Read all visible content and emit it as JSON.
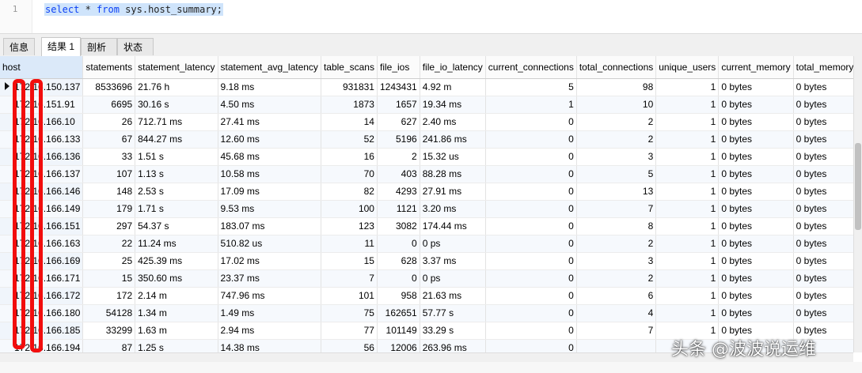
{
  "editor": {
    "line_number": "1",
    "query_keyword_select": "select",
    "query_star": " * ",
    "query_keyword_from": "from",
    "query_rest": " sys.host_summary;"
  },
  "tabs": [
    {
      "label": "信息"
    },
    {
      "label": "结果 1"
    },
    {
      "label": "剖析"
    },
    {
      "label": "状态"
    }
  ],
  "columns": [
    "host",
    "statements",
    "statement_latency",
    "statement_avg_latency",
    "table_scans",
    "file_ios",
    "file_io_latency",
    "current_connections",
    "total_connections",
    "unique_users",
    "current_memory",
    "total_memory"
  ],
  "rows": [
    [
      "172.16.150.137",
      "8533696",
      "21.76 h",
      "9.18 ms",
      "931831",
      "1243431",
      "4.92 m",
      "5",
      "98",
      "1",
      "0 bytes",
      "0 bytes"
    ],
    [
      "172.16.151.91",
      "6695",
      "30.16 s",
      "4.50 ms",
      "1873",
      "1657",
      "19.34 ms",
      "1",
      "10",
      "1",
      "0 bytes",
      "0 bytes"
    ],
    [
      "172.16.166.10",
      "26",
      "712.71 ms",
      "27.41 ms",
      "14",
      "627",
      "2.40 ms",
      "0",
      "2",
      "1",
      "0 bytes",
      "0 bytes"
    ],
    [
      "172.16.166.133",
      "67",
      "844.27 ms",
      "12.60 ms",
      "52",
      "5196",
      "241.86 ms",
      "0",
      "2",
      "1",
      "0 bytes",
      "0 bytes"
    ],
    [
      "172.16.166.136",
      "33",
      "1.51 s",
      "45.68 ms",
      "16",
      "2",
      "15.32 us",
      "0",
      "3",
      "1",
      "0 bytes",
      "0 bytes"
    ],
    [
      "172.16.166.137",
      "107",
      "1.13 s",
      "10.58 ms",
      "70",
      "403",
      "88.28 ms",
      "0",
      "5",
      "1",
      "0 bytes",
      "0 bytes"
    ],
    [
      "172.16.166.146",
      "148",
      "2.53 s",
      "17.09 ms",
      "82",
      "4293",
      "27.91 ms",
      "0",
      "13",
      "1",
      "0 bytes",
      "0 bytes"
    ],
    [
      "172.16.166.149",
      "179",
      "1.71 s",
      "9.53 ms",
      "100",
      "1121",
      "3.20 ms",
      "0",
      "7",
      "1",
      "0 bytes",
      "0 bytes"
    ],
    [
      "172.16.166.151",
      "297",
      "54.37 s",
      "183.07 ms",
      "123",
      "3082",
      "174.44 ms",
      "0",
      "8",
      "1",
      "0 bytes",
      "0 bytes"
    ],
    [
      "172.16.166.163",
      "22",
      "11.24 ms",
      "510.82 us",
      "11",
      "0",
      "0 ps",
      "0",
      "2",
      "1",
      "0 bytes",
      "0 bytes"
    ],
    [
      "172.16.166.169",
      "25",
      "425.39 ms",
      "17.02 ms",
      "15",
      "628",
      "3.37 ms",
      "0",
      "3",
      "1",
      "0 bytes",
      "0 bytes"
    ],
    [
      "172.16.166.171",
      "15",
      "350.60 ms",
      "23.37 ms",
      "7",
      "0",
      "0 ps",
      "0",
      "2",
      "1",
      "0 bytes",
      "0 bytes"
    ],
    [
      "172.16.166.172",
      "172",
      "2.14 m",
      "747.96 ms",
      "101",
      "958",
      "21.63 ms",
      "0",
      "6",
      "1",
      "0 bytes",
      "0 bytes"
    ],
    [
      "172.16.166.180",
      "54128",
      "1.34 m",
      "1.49 ms",
      "75",
      "162651",
      "57.77 s",
      "0",
      "4",
      "1",
      "0 bytes",
      "0 bytes"
    ],
    [
      "172.16.166.185",
      "33299",
      "1.63 m",
      "2.94 ms",
      "77",
      "101149",
      "33.29 s",
      "0",
      "7",
      "1",
      "0 bytes",
      "0 bytes"
    ],
    [
      "172.16.166.194",
      "87",
      "1.25 s",
      "14.38 ms",
      "56",
      "12006",
      "263.96 ms",
      "0",
      "",
      "",
      "",
      ""
    ]
  ],
  "watermark": "头条 @波波说运维",
  "colors": {
    "annotation": "#f20d0d",
    "sql_keyword": "#0b3ff5",
    "selection": "#cfe4fb"
  }
}
